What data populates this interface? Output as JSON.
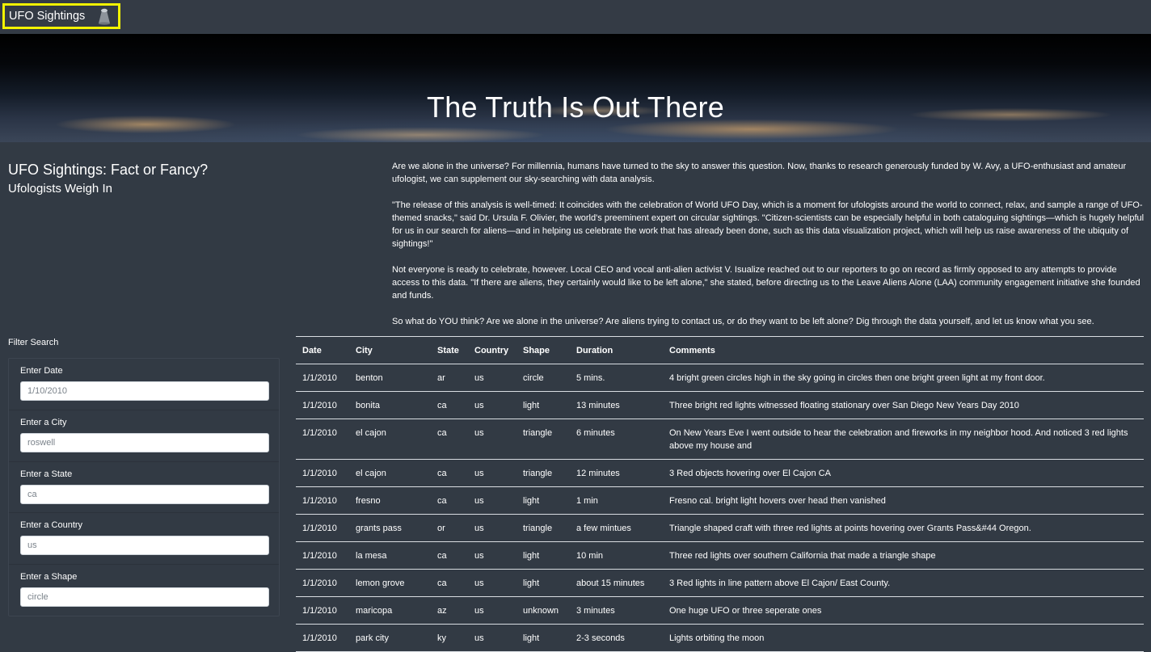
{
  "navbar": {
    "brand": "UFO Sightings",
    "brand_icon": "ufo-icon"
  },
  "hero": {
    "title": "The Truth Is Out There"
  },
  "intro": {
    "heading": "UFO Sightings: Fact or Fancy?",
    "subheading": "Ufologists Weigh In",
    "paragraphs": [
      "Are we alone in the universe? For millennia, humans have turned to the sky to answer this question. Now, thanks to research generously funded by W. Avy, a UFO-enthusiast and amateur ufologist, we can supplement our sky-searching with data analysis.",
      "\"The release of this analysis is well-timed: It coincides with the celebration of World UFO Day, which is a moment for ufologists around the world to connect, relax, and sample a range of UFO-themed snacks,\" said Dr. Ursula F. Olivier, the world's preeminent expert on circular sightings. \"Citizen-scientists can be especially helpful in both cataloguing sightings—which is hugely helpful for us in our search for aliens—and in helping us celebrate the work that has already been done, such as this data visualization project, which will help us raise awareness of the ubiquity of sightings!\"",
      "Not everyone is ready to celebrate, however. Local CEO and vocal anti-alien activist V. Isualize reached out to our reporters to go on record as firmly opposed to any attempts to provide access to this data. \"If there are aliens, they certainly would like to be left alone,\" she stated, before directing us to the Leave Aliens Alone (LAA) community engagement initiative she founded and funds.",
      "So what do YOU think? Are we alone in the universe? Are aliens trying to contact us, or do they want to be left alone? Dig through the data yourself, and let us know what you see."
    ]
  },
  "filters": {
    "title": "Filter Search",
    "items": [
      {
        "label": "Enter Date",
        "placeholder": "1/10/2010"
      },
      {
        "label": "Enter a City",
        "placeholder": "roswell"
      },
      {
        "label": "Enter a State",
        "placeholder": "ca"
      },
      {
        "label": "Enter a Country",
        "placeholder": "us"
      },
      {
        "label": "Enter a Shape",
        "placeholder": "circle"
      }
    ]
  },
  "table": {
    "headers": [
      "Date",
      "City",
      "State",
      "Country",
      "Shape",
      "Duration",
      "Comments"
    ],
    "rows": [
      [
        "1/1/2010",
        "benton",
        "ar",
        "us",
        "circle",
        "5 mins.",
        "4 bright green circles high in the sky going in circles then one bright green light at my front door."
      ],
      [
        "1/1/2010",
        "bonita",
        "ca",
        "us",
        "light",
        "13 minutes",
        "Three bright red lights witnessed floating stationary over San Diego New Years Day 2010"
      ],
      [
        "1/1/2010",
        "el cajon",
        "ca",
        "us",
        "triangle",
        "6 minutes",
        "On New Years Eve I went outside to hear the celebration and fireworks in my neighbor hood. And noticed 3 red lights above my house and"
      ],
      [
        "1/1/2010",
        "el cajon",
        "ca",
        "us",
        "triangle",
        "12 minutes",
        "3 Red objects hovering over El Cajon CA"
      ],
      [
        "1/1/2010",
        "fresno",
        "ca",
        "us",
        "light",
        "1 min",
        "Fresno cal. bright light hovers over head then vanished"
      ],
      [
        "1/1/2010",
        "grants pass",
        "or",
        "us",
        "triangle",
        "a few mintues",
        "Triangle shaped craft with three red lights at points hovering over Grants Pass&#44 Oregon."
      ],
      [
        "1/1/2010",
        "la mesa",
        "ca",
        "us",
        "light",
        "10 min",
        "Three red lights over southern California that made a triangle shape"
      ],
      [
        "1/1/2010",
        "lemon grove",
        "ca",
        "us",
        "light",
        "about 15 minutes",
        "3 Red lights in line pattern above El Cajon/ East County."
      ],
      [
        "1/1/2010",
        "maricopa",
        "az",
        "us",
        "unknown",
        "3 minutes",
        "One huge UFO or three seperate ones"
      ],
      [
        "1/1/2010",
        "park city",
        "ky",
        "us",
        "light",
        "2-3 seconds",
        "Lights orbiting the moon"
      ]
    ]
  }
}
